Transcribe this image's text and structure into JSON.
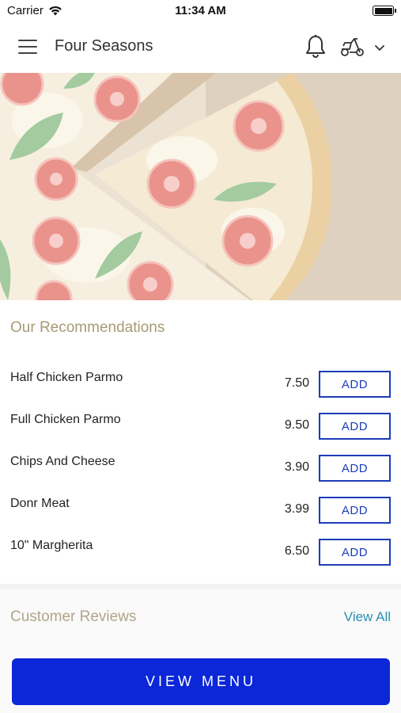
{
  "status_bar": {
    "carrier": "Carrier",
    "time": "11:34 AM",
    "icons": [
      "wifi-icon",
      "battery-icon"
    ]
  },
  "nav": {
    "title": "Four Seasons",
    "icons": [
      "menu-icon",
      "bell-icon",
      "scooter-icon",
      "chevron-down-icon"
    ]
  },
  "hero": {
    "image": "pizza-photo"
  },
  "recommendations": {
    "title": "Our Recommendations",
    "items": [
      {
        "name": "Half Chicken Parmo",
        "price": "7.50",
        "action": "ADD"
      },
      {
        "name": "Full Chicken Parmo",
        "price": "9.50",
        "action": "ADD"
      },
      {
        "name": "Chips And Cheese",
        "price": "3.90",
        "action": "ADD"
      },
      {
        "name": "Donr Meat",
        "price": "3.99",
        "action": "ADD"
      },
      {
        "name": "10\" Margherita",
        "price": "6.50",
        "action": "ADD"
      }
    ]
  },
  "reviews": {
    "title": "Customer Reviews",
    "view_all": "View All"
  },
  "cta": {
    "label": "VIEW MENU"
  },
  "colors": {
    "primary_blue": "#0b27d8",
    "add_border": "#1b3db8",
    "section_title": "#a89a75",
    "link": "#2a8fb5"
  }
}
